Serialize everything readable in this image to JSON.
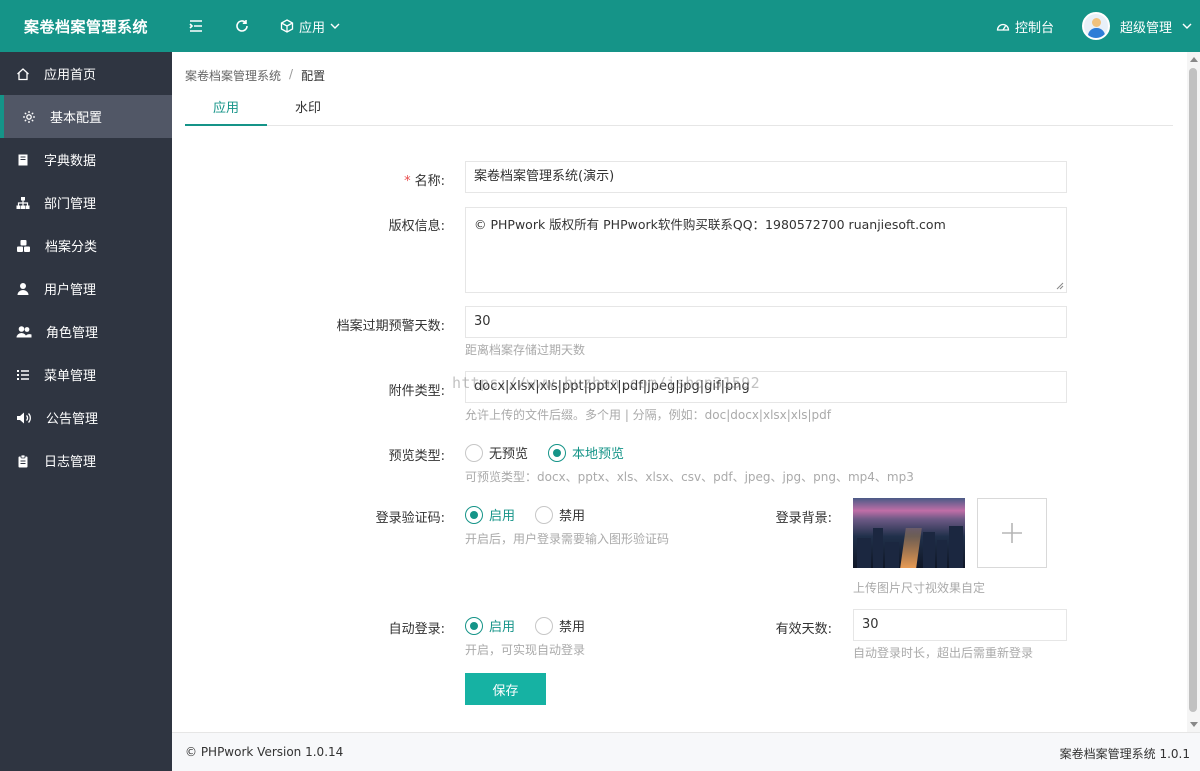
{
  "header": {
    "brand": "案卷档案管理系统",
    "app_menu": "应用",
    "console": "控制台",
    "user": "超级管理"
  },
  "sidebar": {
    "items": [
      {
        "label": "应用首页",
        "icon": "home-icon"
      },
      {
        "label": "基本配置",
        "icon": "gear-icon",
        "active": true
      },
      {
        "label": "字典数据",
        "icon": "book-icon"
      },
      {
        "label": "部门管理",
        "icon": "sitemap-icon"
      },
      {
        "label": "档案分类",
        "icon": "cubes-icon"
      },
      {
        "label": "用户管理",
        "icon": "user-icon"
      },
      {
        "label": "角色管理",
        "icon": "users-icon"
      },
      {
        "label": "菜单管理",
        "icon": "list-icon"
      },
      {
        "label": "公告管理",
        "icon": "volume-icon"
      },
      {
        "label": "日志管理",
        "icon": "clipboard-icon"
      }
    ]
  },
  "breadcrumb": {
    "root": "案卷档案管理系统",
    "sep": "/",
    "current": "配置"
  },
  "tabs": [
    {
      "label": "应用",
      "active": true
    },
    {
      "label": "水印",
      "active": false
    }
  ],
  "form": {
    "name": {
      "label": "名称:",
      "value": "案卷档案管理系统(演示)"
    },
    "copyright": {
      "label": "版权信息:",
      "value": "© PHPwork 版权所有 PHPwork软件购买联系QQ：1980572700 ruanjiesoft.com"
    },
    "expire_days": {
      "label": "档案过期预警天数:",
      "value": "30",
      "hint": "距离档案存储过期天数"
    },
    "attach_types": {
      "label": "附件类型:",
      "value": "docx|xlsx|xls|ppt|pptx|pdf|jpeg|jpg|gif|png",
      "hint": "允许上传的文件后缀。多个用 | 分隔，例如：doc|docx|xlsx|xls|pdf"
    },
    "preview_type": {
      "label": "预览类型:",
      "options": [
        "无预览",
        "本地预览"
      ],
      "selected": 1,
      "hint": "可预览类型：docx、pptx、xls、xlsx、csv、pdf、jpeg、jpg、png、mp4、mp3"
    },
    "captcha": {
      "label": "登录验证码:",
      "options": [
        "启用",
        "禁用"
      ],
      "selected": 0,
      "hint": "开启后，用户登录需要输入图形验证码"
    },
    "login_bg": {
      "label": "登录背景:",
      "hint": "上传图片尺寸视效果自定"
    },
    "auto_login": {
      "label": "自动登录:",
      "options": [
        "启用",
        "禁用"
      ],
      "selected": 0,
      "hint": "开启，可实现自动登录"
    },
    "valid_days": {
      "label": "有效天数:",
      "value": "30",
      "hint": "自动登录时长，超出后需重新登录"
    },
    "save": "保存"
  },
  "watermark_text": "https://www.huzhan.com/ishop31592",
  "footer": {
    "left": "© PHPwork Version 1.0.14",
    "right": "案卷档案管理系统 1.0.1"
  },
  "colors": {
    "primary": "#159488",
    "button": "#16b2a3",
    "sidebar_bg": "#2f3541"
  }
}
